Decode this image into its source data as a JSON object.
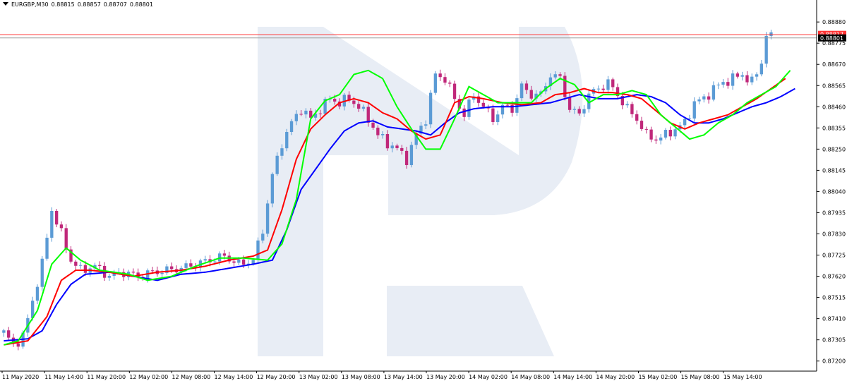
{
  "header": {
    "symbol": "EURGBP,M30",
    "open": "0.88815",
    "high": "0.88857",
    "low": "0.88707",
    "close": "0.88801"
  },
  "colors": {
    "bull": "#5b9bd5",
    "bear": "#c0287a",
    "ma_fast": "#00ff00",
    "ma_mid": "#ff0000",
    "ma_slow": "#0000ff",
    "line_high": "#ff3333",
    "line_price": "#999999",
    "watermark": "#e8edf5"
  },
  "chart_data": {
    "type": "candlestick",
    "title": "EURGBP,M30",
    "y_range": [
      0.8715,
      0.8894
    ],
    "y_ticks": [
      "0.88880",
      "0.88775",
      "0.88670",
      "0.88565",
      "0.88460",
      "0.88355",
      "0.88250",
      "0.88145",
      "0.88040",
      "0.87935",
      "0.87830",
      "0.87725",
      "0.87620",
      "0.87515",
      "0.87410",
      "0.87305",
      "0.87200"
    ],
    "x_ticks": [
      "11 May 2020",
      "11 May 14:00",
      "11 May 20:00",
      "12 May 02:00",
      "12 May 08:00",
      "12 May 14:00",
      "12 May 20:00",
      "13 May 02:00",
      "13 May 08:00",
      "13 May 14:00",
      "13 May 20:00",
      "14 May 02:00",
      "14 May 08:00",
      "14 May 14:00",
      "14 May 20:00",
      "15 May 02:00",
      "15 May 08:00",
      "15 May 14:00"
    ],
    "price_labels": {
      "high_line": "0.88817",
      "current": "0.88801"
    },
    "grid": false,
    "ma_fast_anchors": [
      [
        0,
        0.8728
      ],
      [
        3,
        0.873
      ],
      [
        7,
        0.8745
      ],
      [
        10,
        0.8768
      ],
      [
        13,
        0.8776
      ],
      [
        16,
        0.877
      ],
      [
        20,
        0.8765
      ],
      [
        26,
        0.8763
      ],
      [
        30,
        0.876
      ],
      [
        35,
        0.8762
      ],
      [
        40,
        0.8767
      ],
      [
        45,
        0.8771
      ],
      [
        50,
        0.8771
      ],
      [
        55,
        0.877
      ],
      [
        58,
        0.8778
      ],
      [
        61,
        0.88
      ],
      [
        64,
        0.884
      ],
      [
        67,
        0.8849
      ],
      [
        70,
        0.8852
      ],
      [
        73,
        0.8862
      ],
      [
        76,
        0.8864
      ],
      [
        79,
        0.886
      ],
      [
        82,
        0.8846
      ],
      [
        85,
        0.8835
      ],
      [
        88,
        0.8825
      ],
      [
        91,
        0.8825
      ],
      [
        94,
        0.884
      ],
      [
        97,
        0.8856
      ],
      [
        100,
        0.8852
      ],
      [
        103,
        0.8848
      ],
      [
        106,
        0.8848
      ],
      [
        110,
        0.8848
      ],
      [
        113,
        0.8855
      ],
      [
        116,
        0.886
      ],
      [
        119,
        0.8857
      ],
      [
        122,
        0.8848
      ],
      [
        125,
        0.8852
      ],
      [
        128,
        0.8852
      ],
      [
        131,
        0.8854
      ],
      [
        134,
        0.8852
      ],
      [
        137,
        0.8842
      ],
      [
        140,
        0.8836
      ],
      [
        143,
        0.883
      ],
      [
        146,
        0.8832
      ],
      [
        149,
        0.8838
      ],
      [
        152,
        0.8842
      ],
      [
        155,
        0.8848
      ],
      [
        158,
        0.8852
      ],
      [
        161,
        0.8856
      ],
      [
        164,
        0.8864
      ]
    ],
    "ma_mid_anchors": [
      [
        0,
        0.8728
      ],
      [
        5,
        0.873
      ],
      [
        9,
        0.8742
      ],
      [
        12,
        0.876
      ],
      [
        15,
        0.8765
      ],
      [
        18,
        0.8765
      ],
      [
        22,
        0.8764
      ],
      [
        27,
        0.8762
      ],
      [
        32,
        0.8764
      ],
      [
        37,
        0.8765
      ],
      [
        42,
        0.8767
      ],
      [
        47,
        0.877
      ],
      [
        52,
        0.8772
      ],
      [
        55,
        0.8775
      ],
      [
        58,
        0.8795
      ],
      [
        61,
        0.882
      ],
      [
        64,
        0.8835
      ],
      [
        67,
        0.8842
      ],
      [
        70,
        0.8848
      ],
      [
        73,
        0.885
      ],
      [
        76,
        0.8848
      ],
      [
        79,
        0.8843
      ],
      [
        82,
        0.884
      ],
      [
        85,
        0.8834
      ],
      [
        88,
        0.883
      ],
      [
        91,
        0.8832
      ],
      [
        94,
        0.8848
      ],
      [
        97,
        0.8851
      ],
      [
        100,
        0.885
      ],
      [
        104,
        0.8848
      ],
      [
        108,
        0.8847
      ],
      [
        112,
        0.8848
      ],
      [
        115,
        0.8852
      ],
      [
        118,
        0.8853
      ],
      [
        121,
        0.8855
      ],
      [
        124,
        0.8853
      ],
      [
        127,
        0.8853
      ],
      [
        130,
        0.8852
      ],
      [
        133,
        0.885
      ],
      [
        136,
        0.8844
      ],
      [
        139,
        0.8838
      ],
      [
        142,
        0.8835
      ],
      [
        145,
        0.8838
      ],
      [
        148,
        0.884
      ],
      [
        151,
        0.8842
      ],
      [
        154,
        0.8846
      ],
      [
        157,
        0.885
      ],
      [
        160,
        0.8855
      ],
      [
        163,
        0.886
      ]
    ],
    "ma_slow_anchors": [
      [
        0,
        0.873
      ],
      [
        5,
        0.8731
      ],
      [
        8,
        0.8735
      ],
      [
        11,
        0.8748
      ],
      [
        14,
        0.8758
      ],
      [
        17,
        0.8763
      ],
      [
        22,
        0.8764
      ],
      [
        27,
        0.8762
      ],
      [
        32,
        0.876
      ],
      [
        37,
        0.8763
      ],
      [
        42,
        0.8764
      ],
      [
        47,
        0.8766
      ],
      [
        52,
        0.8768
      ],
      [
        56,
        0.877
      ],
      [
        59,
        0.8785
      ],
      [
        62,
        0.8805
      ],
      [
        65,
        0.8815
      ],
      [
        68,
        0.8825
      ],
      [
        71,
        0.8834
      ],
      [
        74,
        0.8838
      ],
      [
        77,
        0.8839
      ],
      [
        80,
        0.8836
      ],
      [
        83,
        0.8835
      ],
      [
        86,
        0.8834
      ],
      [
        89,
        0.8832
      ],
      [
        92,
        0.8838
      ],
      [
        95,
        0.8843
      ],
      [
        98,
        0.8845
      ],
      [
        102,
        0.8846
      ],
      [
        106,
        0.8846
      ],
      [
        110,
        0.8847
      ],
      [
        114,
        0.8848
      ],
      [
        117,
        0.885
      ],
      [
        120,
        0.8852
      ],
      [
        124,
        0.885
      ],
      [
        128,
        0.885
      ],
      [
        132,
        0.8852
      ],
      [
        135,
        0.8851
      ],
      [
        138,
        0.8848
      ],
      [
        141,
        0.8842
      ],
      [
        144,
        0.8838
      ],
      [
        147,
        0.8838
      ],
      [
        150,
        0.884
      ],
      [
        153,
        0.8843
      ],
      [
        156,
        0.8846
      ],
      [
        159,
        0.8848
      ],
      [
        162,
        0.8851
      ],
      [
        165,
        0.8855
      ]
    ],
    "close_anchors": [
      [
        0,
        0.8734
      ],
      [
        2,
        0.8728
      ],
      [
        4,
        0.8732
      ],
      [
        6,
        0.875
      ],
      [
        8,
        0.8768
      ],
      [
        10,
        0.8795
      ],
      [
        12,
        0.8783
      ],
      [
        14,
        0.877
      ],
      [
        16,
        0.8765
      ],
      [
        19,
        0.8767
      ],
      [
        22,
        0.8762
      ],
      [
        25,
        0.8764
      ],
      [
        28,
        0.8762
      ],
      [
        31,
        0.8764
      ],
      [
        34,
        0.8765
      ],
      [
        37,
        0.8766
      ],
      [
        40,
        0.8768
      ],
      [
        43,
        0.877
      ],
      [
        46,
        0.8772
      ],
      [
        49,
        0.8768
      ],
      [
        52,
        0.877
      ],
      [
        54,
        0.8785
      ],
      [
        56,
        0.8812
      ],
      [
        58,
        0.8828
      ],
      [
        60,
        0.8838
      ],
      [
        62,
        0.8845
      ],
      [
        64,
        0.884
      ],
      [
        66,
        0.8845
      ],
      [
        68,
        0.885
      ],
      [
        70,
        0.8848
      ],
      [
        72,
        0.885
      ],
      [
        74,
        0.8846
      ],
      [
        76,
        0.884
      ],
      [
        78,
        0.8832
      ],
      [
        80,
        0.8828
      ],
      [
        82,
        0.8825
      ],
      [
        84,
        0.882
      ],
      [
        86,
        0.8832
      ],
      [
        88,
        0.884
      ],
      [
        90,
        0.8862
      ],
      [
        92,
        0.886
      ],
      [
        94,
        0.885
      ],
      [
        96,
        0.8842
      ],
      [
        98,
        0.8852
      ],
      [
        100,
        0.8846
      ],
      [
        102,
        0.884
      ],
      [
        104,
        0.8846
      ],
      [
        106,
        0.8845
      ],
      [
        108,
        0.8856
      ],
      [
        110,
        0.8852
      ],
      [
        112,
        0.8852
      ],
      [
        114,
        0.8862
      ],
      [
        116,
        0.886
      ],
      [
        118,
        0.8845
      ],
      [
        120,
        0.8842
      ],
      [
        122,
        0.8852
      ],
      [
        124,
        0.8855
      ],
      [
        126,
        0.8858
      ],
      [
        128,
        0.8852
      ],
      [
        130,
        0.8845
      ],
      [
        132,
        0.884
      ],
      [
        134,
        0.8832
      ],
      [
        136,
        0.883
      ],
      [
        138,
        0.8832
      ],
      [
        140,
        0.8835
      ],
      [
        142,
        0.8838
      ],
      [
        144,
        0.8848
      ],
      [
        146,
        0.885
      ],
      [
        148,
        0.8855
      ],
      [
        150,
        0.8858
      ],
      [
        152,
        0.886
      ],
      [
        154,
        0.8862
      ],
      [
        156,
        0.8858
      ],
      [
        158,
        0.8868
      ],
      [
        159,
        0.8882
      ],
      [
        160,
        0.888
      ]
    ]
  }
}
